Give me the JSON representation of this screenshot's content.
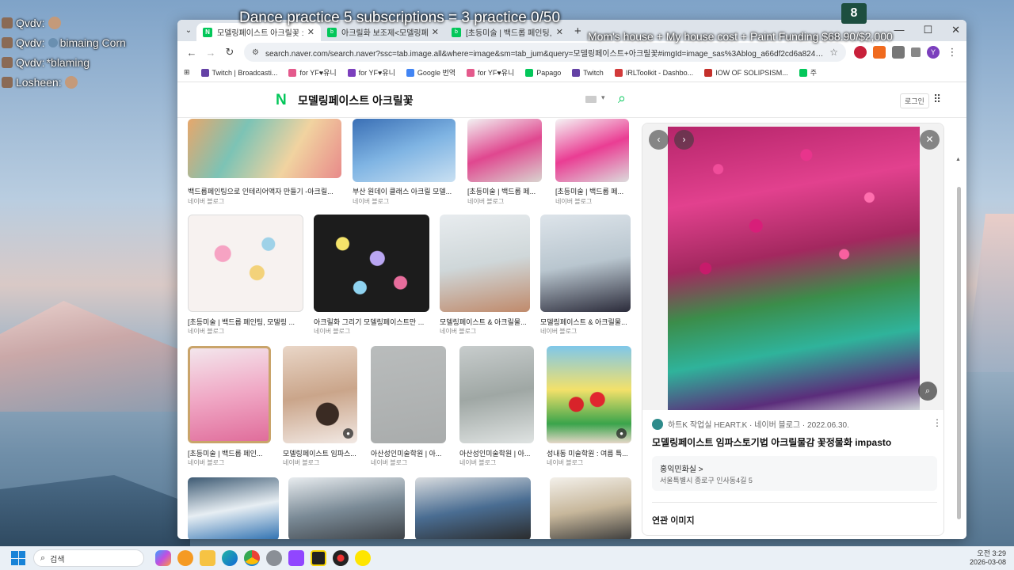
{
  "chat": [
    {
      "name": "Qvdv:",
      "msg": ""
    },
    {
      "name": "Qvdv:",
      "msg": "bimaing Corn"
    },
    {
      "name": "Qvdv:",
      "msg": "*blaming"
    },
    {
      "name": "Losheen:",
      "msg": ""
    }
  ],
  "overlay": {
    "dance": "Dance practice 5 subscriptions = 3 practice 0/50",
    "funding": "Mom's house + My house cost + Paint Funding $68.90/$2,000",
    "logo": "8"
  },
  "browser": {
    "tabs": [
      {
        "title": "모델링페이스트 아크릴꽃 : 네이버",
        "icon": "naver"
      },
      {
        "title": "아크릴화 보조제<모델링페이스트",
        "icon": "blog"
      },
      {
        "title": "[초등미술 | 백드롭 페인팅, 모",
        "icon": "blog"
      }
    ],
    "url": "search.naver.com/search.naver?ssc=tab.image.all&where=image&sm=tab_jum&query=모델링페이스트+아크릴꽃#imgId=image_sas%3Ablog_a66df2cd6a82436a6f652fb...",
    "bookmarks": [
      "Twitch | Broadcasti...",
      "for YF♥유니",
      "for YF♥유니",
      "Google 번역",
      "for YF♥유니",
      "Papago",
      "Twitch",
      "IRLToolkit - Dashbo...",
      "IOW OF SOLIPSISM...",
      "주"
    ]
  },
  "naver": {
    "logo": "N",
    "query": "모델링페이스트 아크릴꽃",
    "login": "로그인"
  },
  "results": [
    {
      "cap": "백드롭페인팅으로 인테리어액자 만들기 -아크릴...",
      "src": "네이버 블로그"
    },
    {
      "cap": "부산 원데이 클래스 아크릴 모델...",
      "src": "네이버 블로그"
    },
    {
      "cap": "[초등미술 | 백드롭 페...",
      "src": "네이버 블로그"
    },
    {
      "cap": "[초등미술 | 백드롭 페...",
      "src": "네이버 블로그"
    },
    {
      "cap": "[초등미술 | 백드롭 페인팅, 모델링 ...",
      "src": "네이버 블로그"
    },
    {
      "cap": "아크릴화 그리기 모델링페이스트만 ...",
      "src": "네이버 블로그"
    },
    {
      "cap": "모델링페이스트 & 아크릴물...",
      "src": "네이버 블로그"
    },
    {
      "cap": "모델링페이스트 & 아크릴물...",
      "src": "네이버 블로그"
    },
    {
      "cap": "[초등미술 | 백드롭 페인...",
      "src": "네이버 블로그"
    },
    {
      "cap": "모델링페이스트 임파스...",
      "src": "네이버 블로그"
    },
    {
      "cap": "아산성인미술학원 | 아...",
      "src": "네이버 블로그"
    },
    {
      "cap": "아산성인미술학원 | 아...",
      "src": "네이버 블로그"
    },
    {
      "cap": "성내동 미술학원 : 여름 특...",
      "src": "네이버 블로그"
    }
  ],
  "detail": {
    "source": "하트K 작업실 HEART.K · 네이버 블로그 · 2022.06.30.",
    "title": "모델링페이스트 임파스토기법 아크릴물감 꽃정물화 impasto",
    "place_name": "홍익민화실 >",
    "place_addr": "서울특별시 종로구 인사동4길 5",
    "related": "연관 이미지"
  },
  "taskbar": {
    "search": "검색",
    "time": "오전 3:29",
    "date": "2026-03-08"
  }
}
